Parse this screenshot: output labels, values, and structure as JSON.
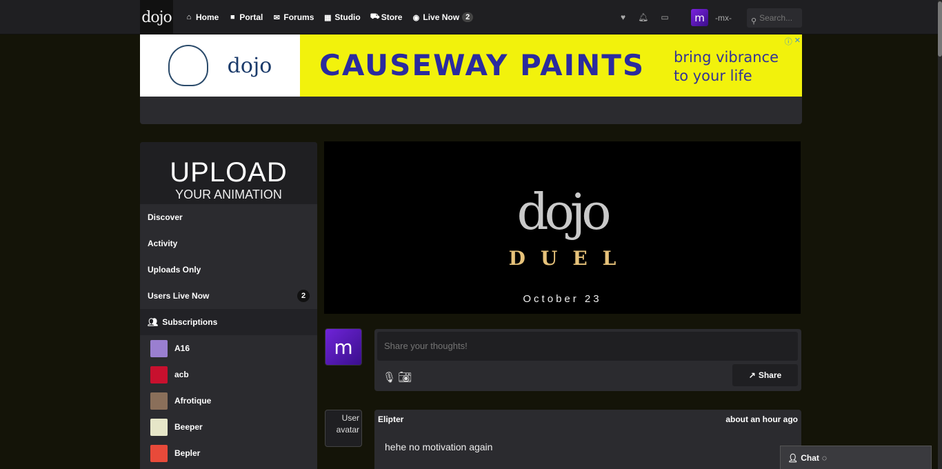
{
  "brand": {
    "logo_text": "dojo"
  },
  "nav": {
    "items": [
      {
        "label": "Home",
        "icon": "home-icon",
        "glyph": "⌂"
      },
      {
        "label": "Portal",
        "icon": "video-icon",
        "glyph": "■"
      },
      {
        "label": "Forums",
        "icon": "comments-icon",
        "glyph": "✉"
      },
      {
        "label": "Studio",
        "icon": "film-icon",
        "glyph": "▦"
      },
      {
        "label": "Store",
        "icon": "cart-icon",
        "glyph": "⛟"
      },
      {
        "label": "Live Now",
        "icon": "eye-icon",
        "glyph": "◉"
      }
    ],
    "live_count": "2"
  },
  "user": {
    "initial": "m",
    "name": "-mx-"
  },
  "search": {
    "placeholder": "Search..."
  },
  "banner": {
    "logo_text": "dojo",
    "ad_name": "CAUSEWAY PAINTS",
    "ad_tagline": "bring vibrance to your life",
    "ad_info_glyph": "ⓘ",
    "ad_close_glyph": "✕"
  },
  "sidebar": {
    "upload_title": "UPLOAD",
    "upload_subtitle": "YOUR ANIMATION",
    "links": [
      {
        "label": "Discover"
      },
      {
        "label": "Activity"
      },
      {
        "label": "Uploads Only"
      },
      {
        "label": "Users Live Now",
        "count": "2"
      }
    ],
    "subscriptions_label": "Subscriptions",
    "subscriptions": [
      {
        "name": "A16",
        "color": "#9a7fd0"
      },
      {
        "name": "acb",
        "color": "#c8102e"
      },
      {
        "name": "Afrotique",
        "color": "#8a6f5a"
      },
      {
        "name": "Beeper",
        "color": "#e6e6c8"
      },
      {
        "name": "Bepler",
        "color": "#e84a3a"
      }
    ]
  },
  "hero": {
    "logo_text": "dojo",
    "title": "DUEL",
    "date": "October 23"
  },
  "composer": {
    "placeholder": "Share your thoughts!",
    "share_label": "Share",
    "avatar_initial": "m"
  },
  "post": {
    "author": "Elipter",
    "time": "about an hour ago",
    "body": "hehe no motivation again",
    "avatar_alt": "User avatar"
  },
  "chat": {
    "label": "Chat"
  },
  "colors": {
    "page_bg": "#141408",
    "panel": "#2b2b2f",
    "accent_purple": "#6f24d8",
    "ad_yellow": "#f2f20c",
    "ad_blue": "#2b2b9e"
  }
}
